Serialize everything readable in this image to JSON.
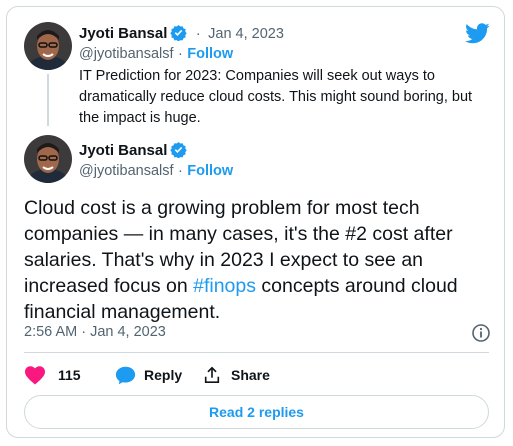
{
  "quoted": {
    "name": "Jyoti Bansal",
    "handle": "@jyotibansalsf",
    "dot": "·",
    "date": "Jan 4, 2023",
    "follow": "Follow",
    "text": "IT Prediction for 2023: Companies will seek out ways to dramatically reduce cloud costs. This might sound boring, but the impact is huge."
  },
  "tweet": {
    "name": "Jyoti Bansal",
    "handle": "@jyotibansalsf",
    "dot": "·",
    "follow": "Follow",
    "text_before": "Cloud cost is a growing problem for most tech companies — in many cases, it's the #2 cost after salaries. That's why in 2023 I expect to see an increased focus on ",
    "hashtag": "#finops",
    "text_after": " concepts around cloud financial management.",
    "timestamp": "2:56 AM · Jan 4, 2023"
  },
  "actions": {
    "like_count": "115",
    "reply_label": "Reply",
    "share_label": "Share"
  },
  "read_replies_label": "Read 2 replies",
  "colors": {
    "accent": "#1d9bf0",
    "like": "#f91880",
    "border": "#cfd9de",
    "muted": "#536471"
  },
  "icons": [
    "twitter-bird-icon",
    "verified-badge-icon",
    "heart-icon",
    "reply-bubble-icon",
    "share-icon",
    "info-icon"
  ]
}
